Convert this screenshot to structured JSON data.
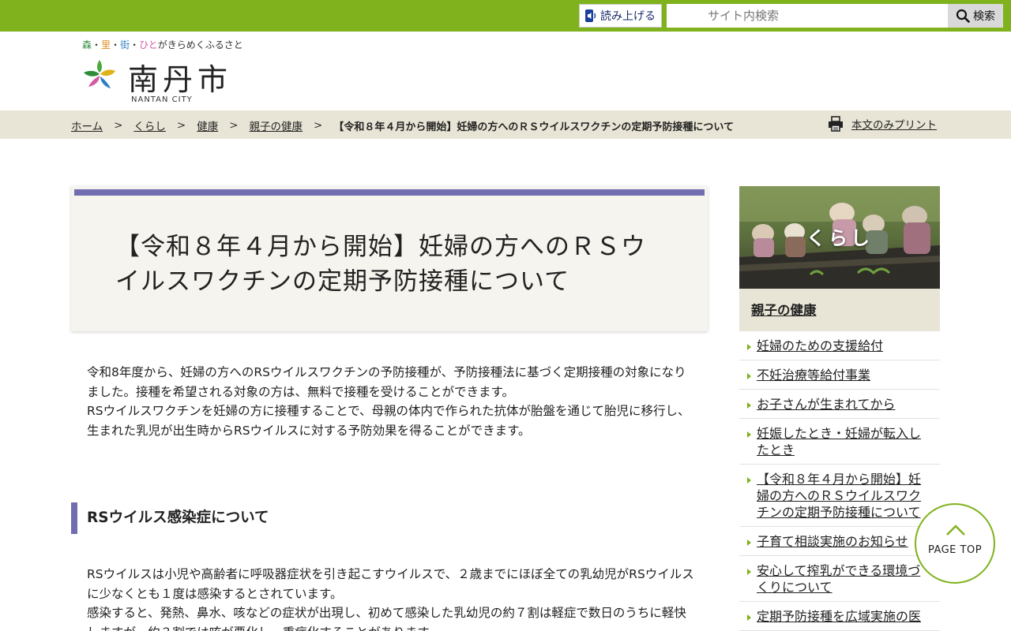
{
  "header": {
    "read_aloud_label": "読み上げる",
    "search_placeholder": "サイト内検索",
    "search_button": "検索",
    "logo": {
      "tagline_parts": [
        "森",
        "・",
        "里",
        "・",
        "街",
        "・",
        "ひと",
        "がきらめくふるさと"
      ],
      "name": "南丹市",
      "sub": "NANTAN CITY"
    }
  },
  "breadcrumb": {
    "items": [
      "ホーム",
      "くらし",
      "健康",
      "親子の健康"
    ],
    "separator": ">",
    "current": "【令和８年４月から開始】妊婦の方へのＲＳウイルスワクチンの定期予防接種について"
  },
  "print_label": "本文のみプリント",
  "main": {
    "title": "【令和８年４月から開始】妊婦の方へのＲＳウイルスワクチンの定期予防接種について",
    "intro_lines": [
      "令和8年度から、妊婦の方へのRSウイルスワクチンの予防接種が、予防接種法に基づく定期接種の対象になりました。接種を希望される対象の方は、無料で接種を受けることができます。",
      "RSウイルスワクチンを妊婦の方に接種することで、母親の体内で作られた抗体が胎盤を通じて胎児に移行し、生まれた乳児が出生時からRSウイルスに対する予防効果を得ることができます。"
    ],
    "section_heading": "RSウイルス感染症について",
    "section_lines": [
      "RSウイルスは小児や高齢者に呼吸器症状を引き起こすウイルスで、２歳までにほぼ全ての乳幼児がRSウイルスに少なくとも１度は感染するとされています。",
      "感染すると、発熱、鼻水、咳などの症状が出現し、初めて感染した乳幼児の約７割は軽症で数日のうちに軽快しますが、約３割では咳が悪化し、重症化することがあります。"
    ]
  },
  "sidebar": {
    "banner_label": "くらし",
    "heading": "親子の健康",
    "items": [
      "妊婦のための支援給付",
      "不妊治療等給付事業",
      "お子さんが生まれてから",
      "妊娠したとき・妊婦が転入したとき",
      "【令和８年４月から開始】妊婦の方へのＲＳウイルスワクチンの定期予防接種について",
      "子育て相談実施のお知らせ",
      "安心して搾乳ができる環境づくりについて",
      "定期予防接種を広域実施の医"
    ]
  },
  "page_top_label": "PAGE TOP",
  "colors": {
    "topbar": "#7fb21c",
    "accent_purple": "#716db0",
    "breadcrumb_bg": "#e9e5d6",
    "title_bg": "#f6f4ee"
  },
  "icons": [
    "speaker-icon",
    "search-icon",
    "print-icon",
    "chevron-up-icon",
    "list-arrow-icon"
  ]
}
